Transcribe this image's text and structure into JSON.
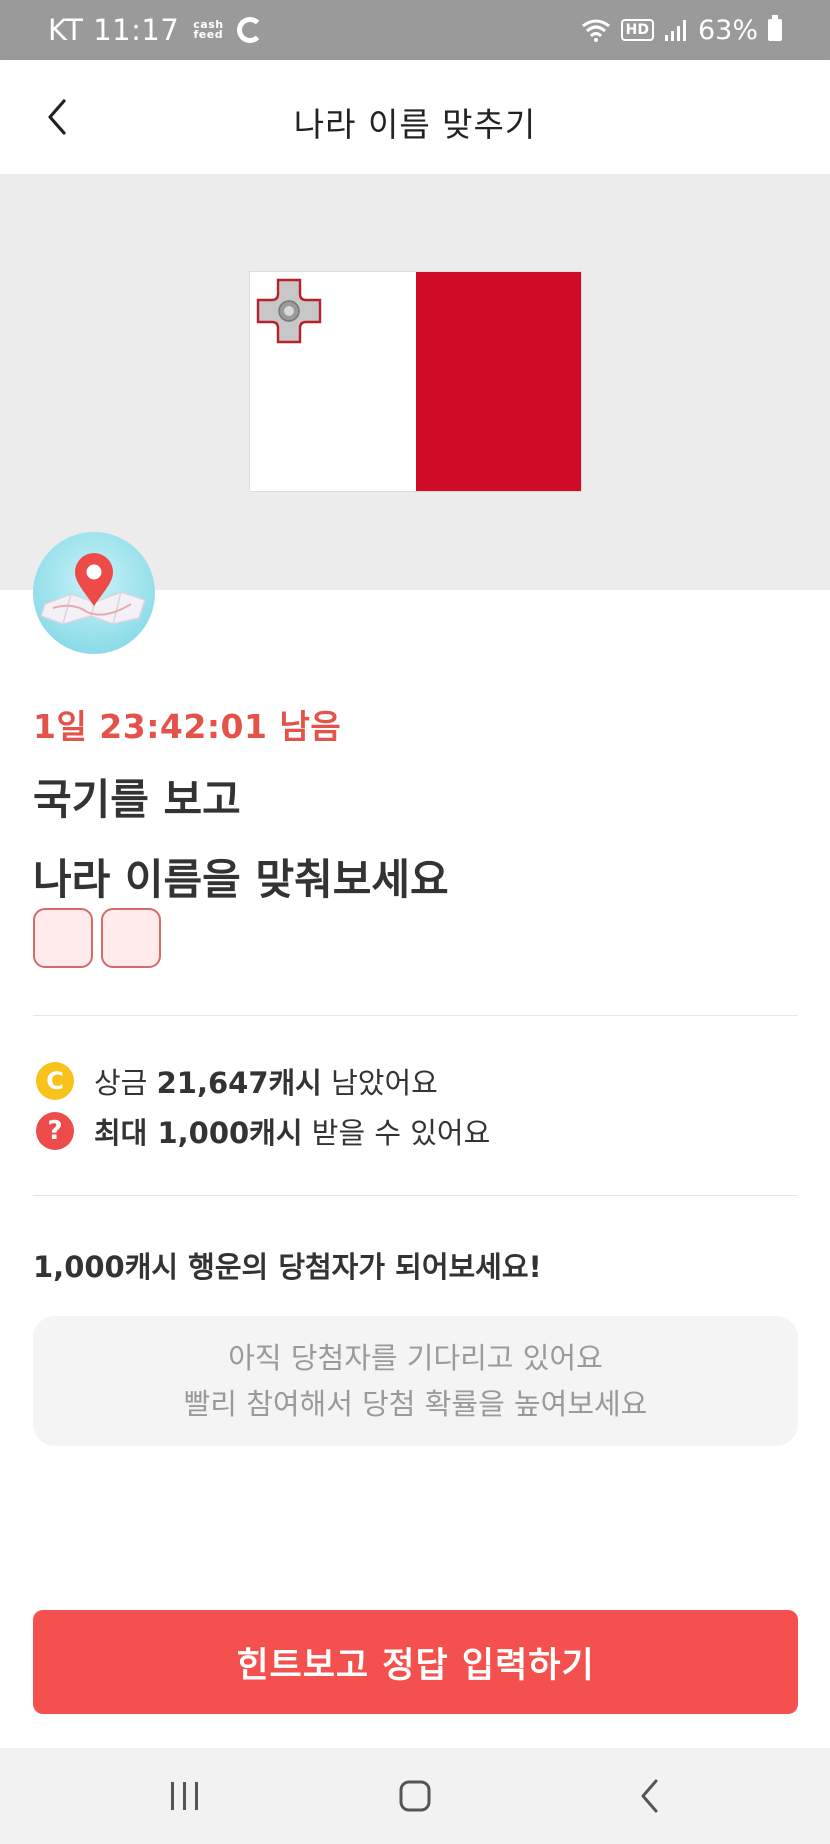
{
  "status_bar": {
    "carrier_time": "KT 11:17",
    "app_badge_line1": "cash",
    "app_badge_line2": "feed",
    "network_label": "HD",
    "battery": "63%"
  },
  "header": {
    "title": "나라 이름 맞추기",
    "back_icon": "chevron-left-icon"
  },
  "flag": {
    "country_hidden": true,
    "colors": {
      "left": "#ffffff",
      "right": "#cf0b27"
    }
  },
  "quiz": {
    "timer": "1일 23:42:01 남음",
    "question_line1": "국기를 보고",
    "question_line2": "나라 이름을 맞춰보세요",
    "answer_slot_count": 2
  },
  "info": {
    "prize_prefix": "상금 ",
    "prize_value": "21,647캐시",
    "prize_suffix": " 남았어요",
    "max_prefix": "최대 1,000캐시",
    "max_suffix": " 받을 수 있어요",
    "coin_glyph": "C",
    "help_glyph": "?"
  },
  "lucky": {
    "title": "1,000캐시 행운의 당첨자가 되어보세요!",
    "empty_line1": "아직 당첨자를 기다리고 있어요",
    "empty_line2": "빨리 참여해서 당첨 확률을 높여보세요"
  },
  "cta": {
    "label": "힌트보고 정답 입력하기",
    "color": "#f4504d"
  },
  "accent": {
    "timer_color": "#e4524a"
  }
}
